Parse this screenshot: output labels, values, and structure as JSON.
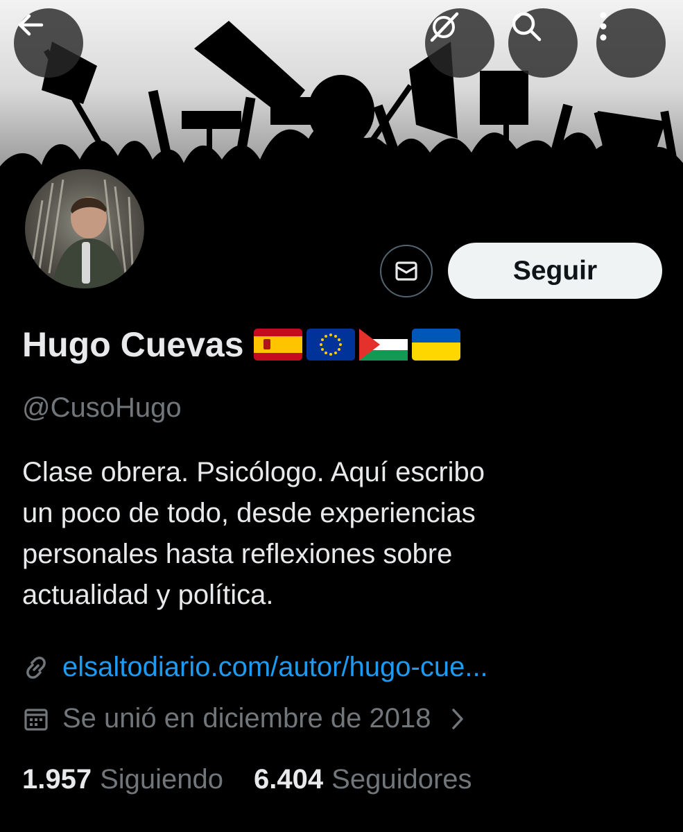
{
  "header": {
    "back_icon": "arrow-left-icon",
    "grok_icon": "grok-slash-icon",
    "search_icon": "search-icon",
    "more_icon": "more-vertical-icon"
  },
  "profile": {
    "name": "Hugo Cuevas",
    "flags": [
      "flag-spain",
      "flag-european-union",
      "flag-palestine",
      "flag-ukraine"
    ],
    "handle": "@CusoHugo",
    "bio_lines": [
      "Clase obrera. Psicólogo. Aquí escribo",
      "un poco de todo, desde experiencias",
      "personales hasta reflexiones sobre",
      "actualidad y política."
    ],
    "website": "elsaltodiario.com/autor/hugo-cue...",
    "joined": "Se unió en diciembre de 2018"
  },
  "actions": {
    "message_icon": "envelope-icon",
    "follow_label": "Seguir"
  },
  "stats": {
    "following_count": "1.957",
    "following_label": "Siguiendo",
    "followers_count": "6.404",
    "followers_label": "Seguidores"
  },
  "colors": {
    "background": "#000000",
    "text": "#e7e9ea",
    "muted": "#71767b",
    "link": "#1d9bf0",
    "button_bg": "#eff3f4"
  }
}
